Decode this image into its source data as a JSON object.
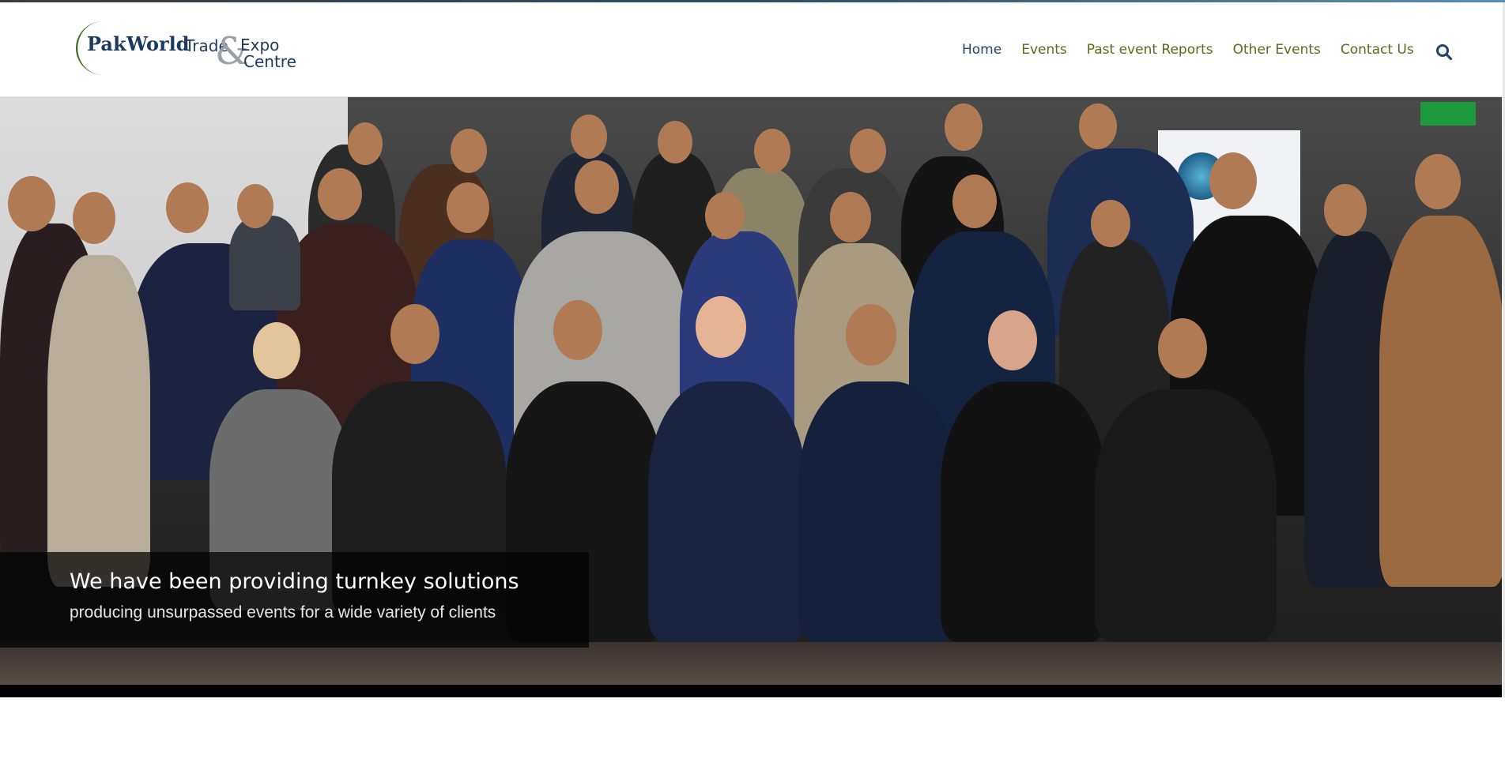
{
  "brand": {
    "logo_words": [
      "Pak",
      "World",
      "Trade",
      "&",
      "Expo",
      "Centre"
    ],
    "colors": {
      "logo_navy": "#1c3a5e",
      "logo_green": "#3f6b1a",
      "logo_gray": "#9aa0a6"
    }
  },
  "nav": {
    "items": [
      {
        "label": "Home",
        "active": true
      },
      {
        "label": "Events",
        "active": false
      },
      {
        "label": "Past event Reports",
        "active": false
      },
      {
        "label": "Other Events",
        "active": false
      },
      {
        "label": "Contact Us",
        "active": false
      }
    ],
    "colors": {
      "active": "#23446b",
      "default": "#5a6b1e"
    },
    "search_icon": "search-icon"
  },
  "hero": {
    "image_alt": "group-photo",
    "caption": {
      "title": "We have been providing turnkey solutions",
      "subtitle": "producing unsurpassed events for a wide variety of clients"
    }
  }
}
